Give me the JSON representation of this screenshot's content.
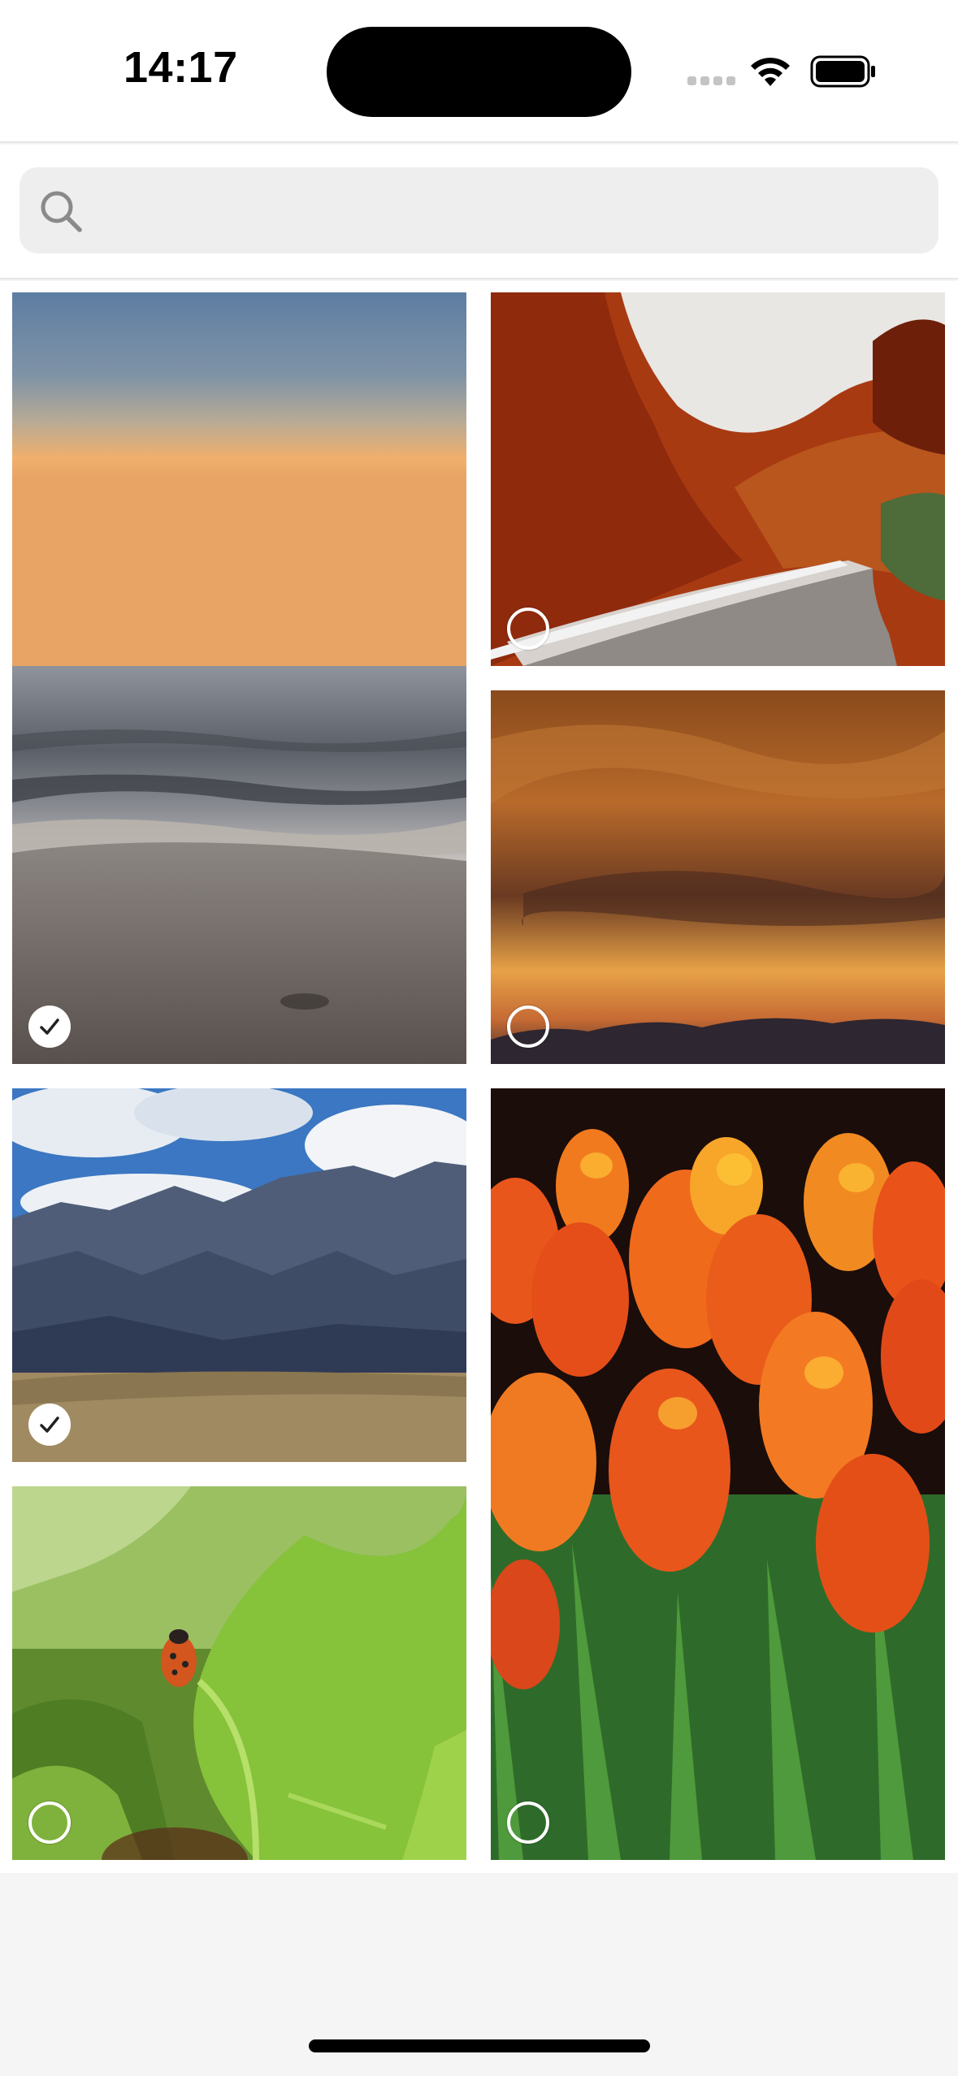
{
  "status_bar": {
    "time": "14:17",
    "icons": [
      "signal-icon",
      "wifi-icon",
      "battery-icon"
    ]
  },
  "search": {
    "value": "",
    "placeholder": "",
    "icon": "search-icon"
  },
  "photos": [
    {
      "name": "sunset-beach",
      "selected": true
    },
    {
      "name": "autumn-road",
      "selected": false
    },
    {
      "name": "orange-cloud-sky",
      "selected": false
    },
    {
      "name": "mountains-clouds",
      "selected": true
    },
    {
      "name": "tulips",
      "selected": false
    },
    {
      "name": "ladybug-leaf",
      "selected": false
    }
  ],
  "colors": {
    "background": "#f5f5f5",
    "search_field": "#eeeeee",
    "selection": "#ffffff"
  }
}
